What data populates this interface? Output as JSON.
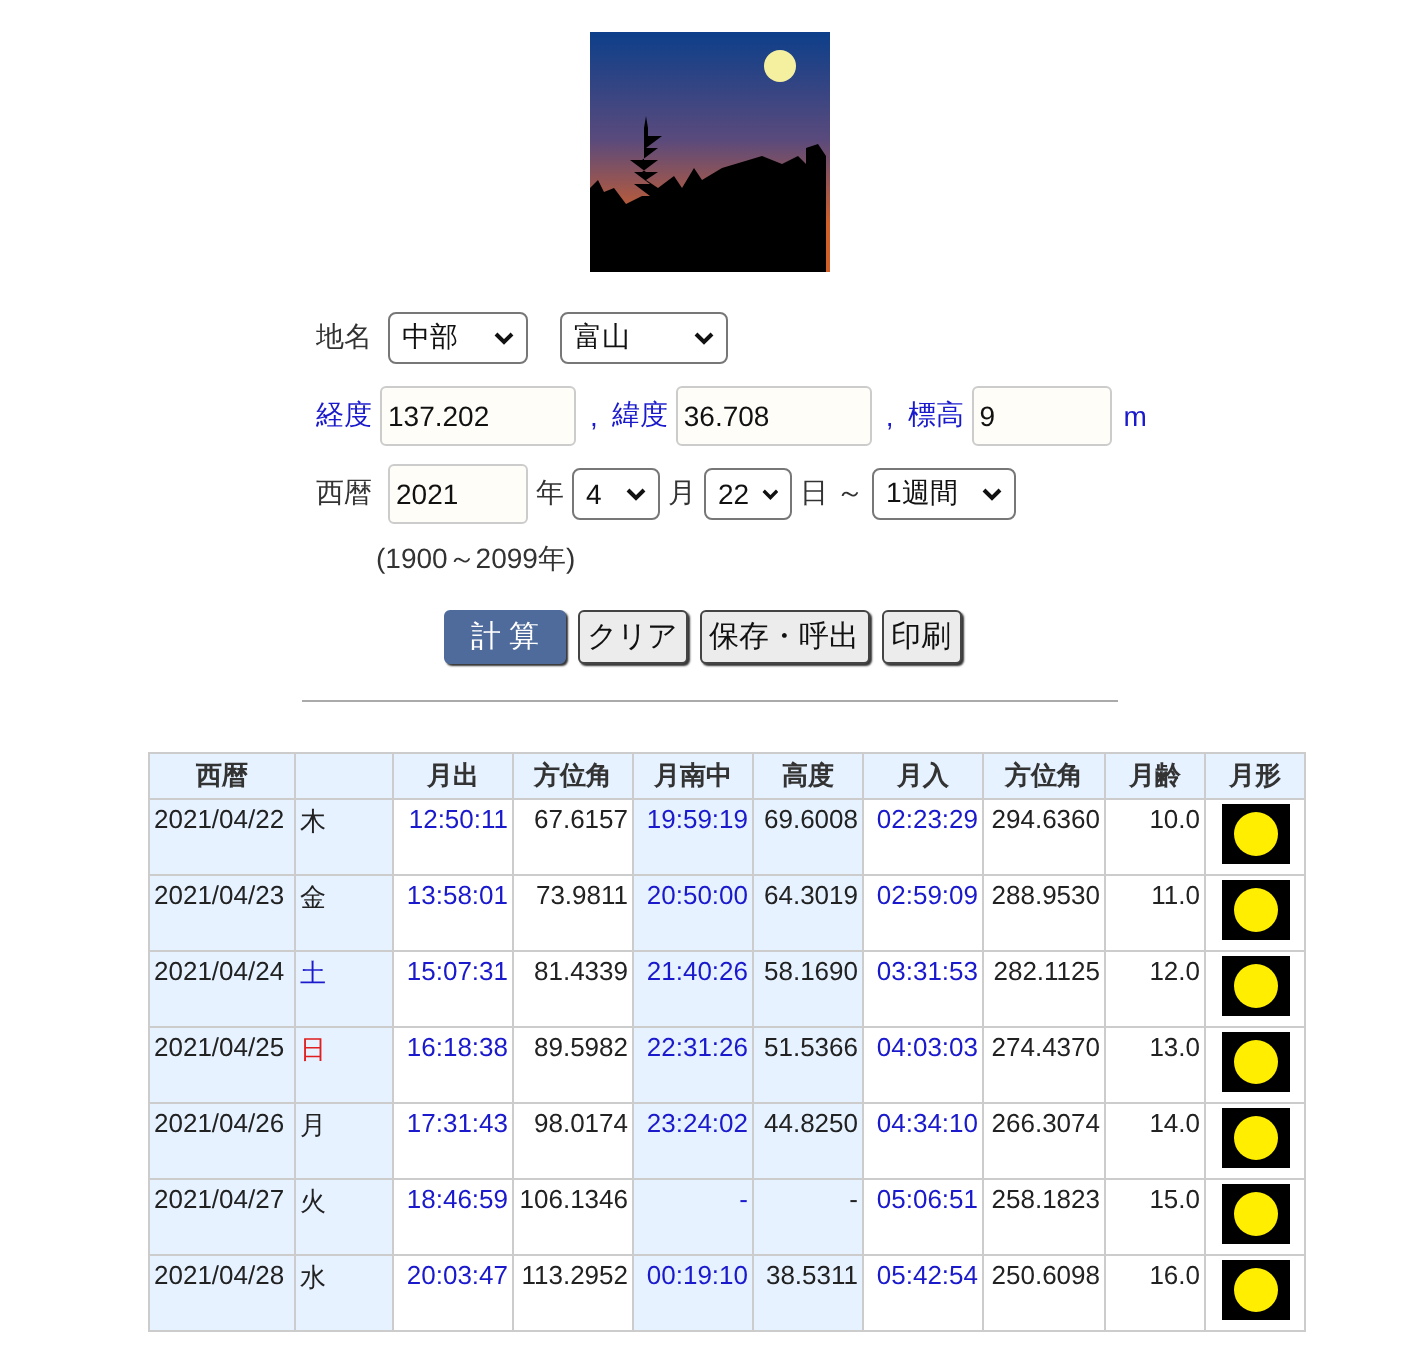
{
  "place": {
    "label": "地名",
    "region": "中部",
    "city": "富山"
  },
  "coords": [
    {
      "label": "経度",
      "value": "137.202"
    },
    {
      "separator": ",",
      "label": "緯度",
      "value": "36.708"
    },
    {
      "separator": ",",
      "label": "標高",
      "value": "9",
      "unit": "m"
    }
  ],
  "date": {
    "label": "西暦",
    "year": "2021",
    "year_unit": "年",
    "month": "4",
    "month_unit": "月",
    "day": "22",
    "day_unit": "日",
    "tilde": "～",
    "period": "1週間",
    "range_note": "(1900～2099年)"
  },
  "buttons": [
    {
      "label": "計 算",
      "kind": "primary"
    },
    {
      "label": "クリア",
      "kind": "normal"
    },
    {
      "label": "保存・呼出",
      "kind": "normal"
    },
    {
      "label": "印刷",
      "kind": "normal"
    }
  ],
  "table": {
    "columns": [
      "西暦",
      "",
      "月出",
      "方位角",
      "月南中",
      "高度",
      "月入",
      "方位角",
      "月齢",
      "月形"
    ],
    "rows": [
      {
        "date": "2021/04/22",
        "weekday": "木",
        "color": "#222222",
        "rise": "12:50:11",
        "rise_az": "67.6157",
        "transit": "19:59:19",
        "altitude": "69.6008",
        "set": "02:23:29",
        "set_az": "294.6360",
        "age": "10.0"
      },
      {
        "date": "2021/04/23",
        "weekday": "金",
        "color": "#222222",
        "rise": "13:58:01",
        "rise_az": "73.9811",
        "transit": "20:50:00",
        "altitude": "64.3019",
        "set": "02:59:09",
        "set_az": "288.9530",
        "age": "11.0"
      },
      {
        "date": "2021/04/24",
        "weekday": "土",
        "color": "#1a1acc",
        "rise": "15:07:31",
        "rise_az": "81.4339",
        "transit": "21:40:26",
        "altitude": "58.1690",
        "set": "03:31:53",
        "set_az": "282.1125",
        "age": "12.0"
      },
      {
        "date": "2021/04/25",
        "weekday": "日",
        "color": "#e02020",
        "rise": "16:18:38",
        "rise_az": "89.5982",
        "transit": "22:31:26",
        "altitude": "51.5366",
        "set": "04:03:03",
        "set_az": "274.4370",
        "age": "13.0"
      },
      {
        "date": "2021/04/26",
        "weekday": "月",
        "color": "#222222",
        "rise": "17:31:43",
        "rise_az": "98.0174",
        "transit": "23:24:02",
        "altitude": "44.8250",
        "set": "04:34:10",
        "set_az": "266.3074",
        "age": "14.0"
      },
      {
        "date": "2021/04/27",
        "weekday": "火",
        "color": "#222222",
        "rise": "18:46:59",
        "rise_az": "106.1346",
        "transit": "-",
        "altitude": "-",
        "set": "05:06:51",
        "set_az": "258.1823",
        "age": "15.0"
      },
      {
        "date": "2021/04/28",
        "weekday": "水",
        "color": "#222222",
        "rise": "20:03:47",
        "rise_az": "113.2952",
        "transit": "00:19:10",
        "altitude": "38.5311",
        "set": "05:42:54",
        "set_az": "250.6098",
        "age": "16.0"
      }
    ]
  }
}
